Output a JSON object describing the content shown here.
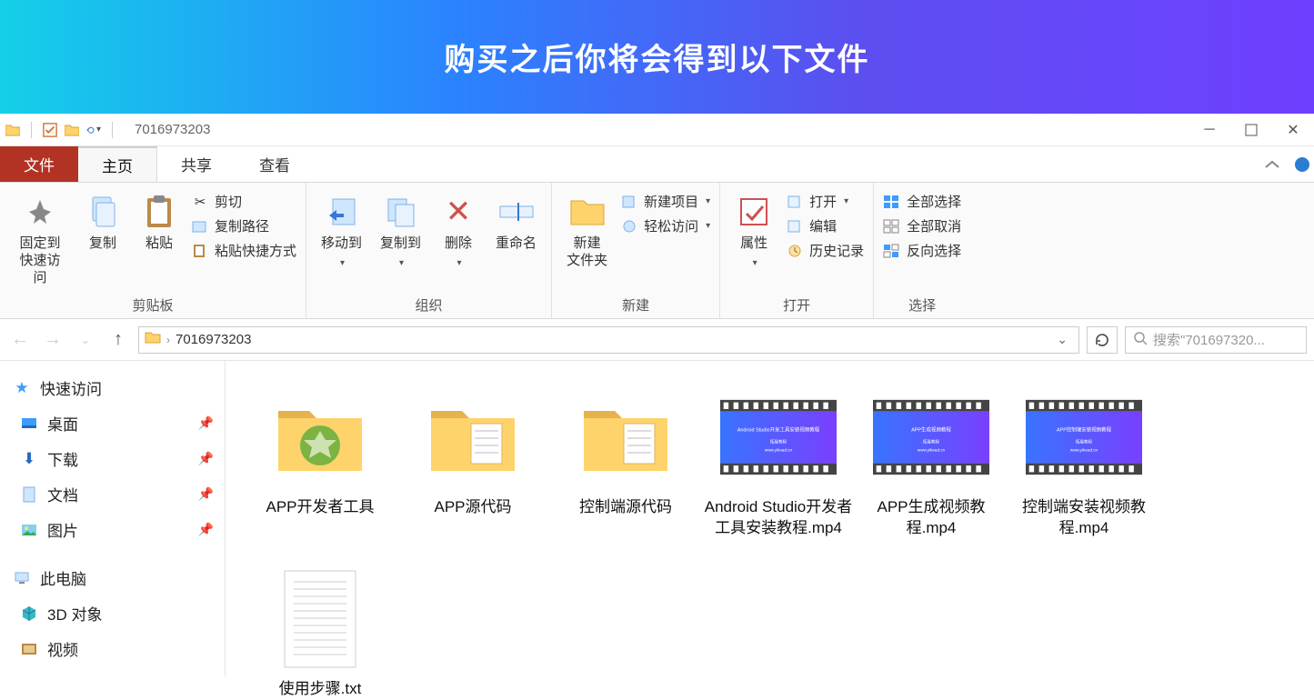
{
  "banner": {
    "title": "购买之后你将会得到以下文件"
  },
  "titlebar": {
    "title": "7016973203"
  },
  "tabs": {
    "file": "文件",
    "home": "主页",
    "share": "共享",
    "view": "查看"
  },
  "ribbon": {
    "clipboard": {
      "label": "剪贴板",
      "pin": "固定到快速访问",
      "copy": "复制",
      "paste": "粘贴",
      "cut": "剪切",
      "copypath": "复制路径",
      "pasteshortcut": "粘贴快捷方式"
    },
    "organize": {
      "label": "组织",
      "moveto": "移动到",
      "copyto": "复制到",
      "delete": "删除",
      "rename": "重命名"
    },
    "new": {
      "label": "新建",
      "newfolder": "新建\n文件夹",
      "newitem": "新建项目",
      "easyaccess": "轻松访问"
    },
    "open": {
      "label": "打开",
      "properties": "属性",
      "open": "打开",
      "edit": "编辑",
      "history": "历史记录"
    },
    "select": {
      "label": "选择",
      "selectall": "全部选择",
      "selectnone": "全部取消",
      "invert": "反向选择"
    }
  },
  "address": {
    "path": "7016973203",
    "searchPlaceholder": "搜索\"701697320..."
  },
  "sidebar": {
    "quickaccess": "快速访问",
    "desktop": "桌面",
    "downloads": "下载",
    "documents": "文档",
    "pictures": "图片",
    "thispc": "此电脑",
    "objects3d": "3D 对象",
    "videos": "视频"
  },
  "files": [
    {
      "name": "APP开发者工具",
      "type": "folder-app"
    },
    {
      "name": "APP源代码",
      "type": "folder"
    },
    {
      "name": "控制端源代码",
      "type": "folder"
    },
    {
      "name": "Android Studio开发者工具安装教程.mp4",
      "type": "video"
    },
    {
      "name": "APP生成视频教程.mp4",
      "type": "video"
    },
    {
      "name": "控制端安装视频教程.mp4",
      "type": "video"
    },
    {
      "name": "使用步骤.txt",
      "type": "txt"
    }
  ]
}
